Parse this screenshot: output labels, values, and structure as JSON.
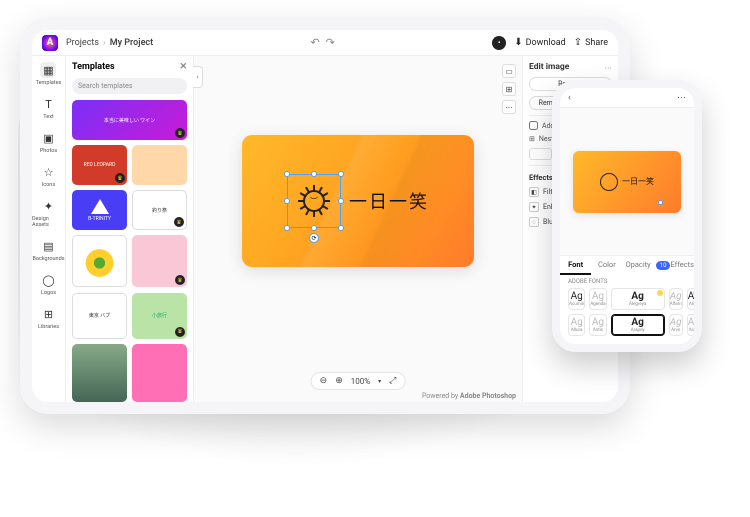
{
  "brand_letter": "A",
  "breadcrumbs": {
    "root": "Projects",
    "project": "My Project"
  },
  "undo_icon": "↶",
  "redo_icon": "↷",
  "user_initial": "•",
  "download_label": "Download",
  "share_label": "Share",
  "sidenav": [
    {
      "icon": "▦",
      "label": "Templates"
    },
    {
      "icon": "T",
      "label": "Text"
    },
    {
      "icon": "▣",
      "label": "Photos"
    },
    {
      "icon": "☆",
      "label": "Icons"
    },
    {
      "icon": "✦",
      "label": "Design Assets"
    },
    {
      "icon": "▤",
      "label": "Backgrounds"
    },
    {
      "icon": "◯",
      "label": "Logos"
    },
    {
      "icon": "⊞",
      "label": "Libraries"
    }
  ],
  "templates": {
    "title": "Templates",
    "search_placeholder": "Search templates",
    "cards": {
      "purple": "本当に美味しい ワイン",
      "red": "RED LEOPARD",
      "peach": "",
      "blue": "B-TRINITY",
      "white": "釣り祭",
      "mint": "東京 バブ",
      "green": "小旅行"
    }
  },
  "canvas_text": "一日一笑",
  "zoom": {
    "out": "⊖",
    "in": "⊕",
    "level": "100%",
    "expand": "⤢"
  },
  "footer_prefix": "Powered by ",
  "footer_brand": "Adobe Photoshop",
  "right": {
    "title": "Edit image",
    "replace": "Replace",
    "remove_bg": "Remove background",
    "add_bg": "Add to background",
    "layout": "Nested",
    "size_w": "",
    "size_h": "",
    "lock": "🔒",
    "flip": "⇋",
    "effects": "Effects",
    "filters": "Filters",
    "enhancements": "Enhancements",
    "blur": "Blur"
  },
  "phone": {
    "back": "‹",
    "menu": "⋯",
    "text": "一日一笑",
    "tabs": {
      "font": "Font",
      "color": "Color",
      "opacity": "Opacity",
      "effects": "Effects",
      "pill": "10"
    },
    "fonts_label": "ADOBE FONTS",
    "fonts": [
      {
        "g": "Ag",
        "n": "Acumin"
      },
      {
        "g": "Ag",
        "n": "Agenda"
      },
      {
        "g": "Ag",
        "n": "Alegreya"
      },
      {
        "g": "Ag",
        "n": "Alfarn"
      },
      {
        "g": "Ag",
        "n": "Alike"
      },
      {
        "g": "Ag",
        "n": "Allura"
      },
      {
        "g": "Ag",
        "n": "Antic"
      },
      {
        "g": "Ag",
        "n": "Arapey"
      },
      {
        "g": "Ag",
        "n": "Arvo"
      },
      {
        "g": "Ag",
        "n": "Asap"
      }
    ]
  }
}
